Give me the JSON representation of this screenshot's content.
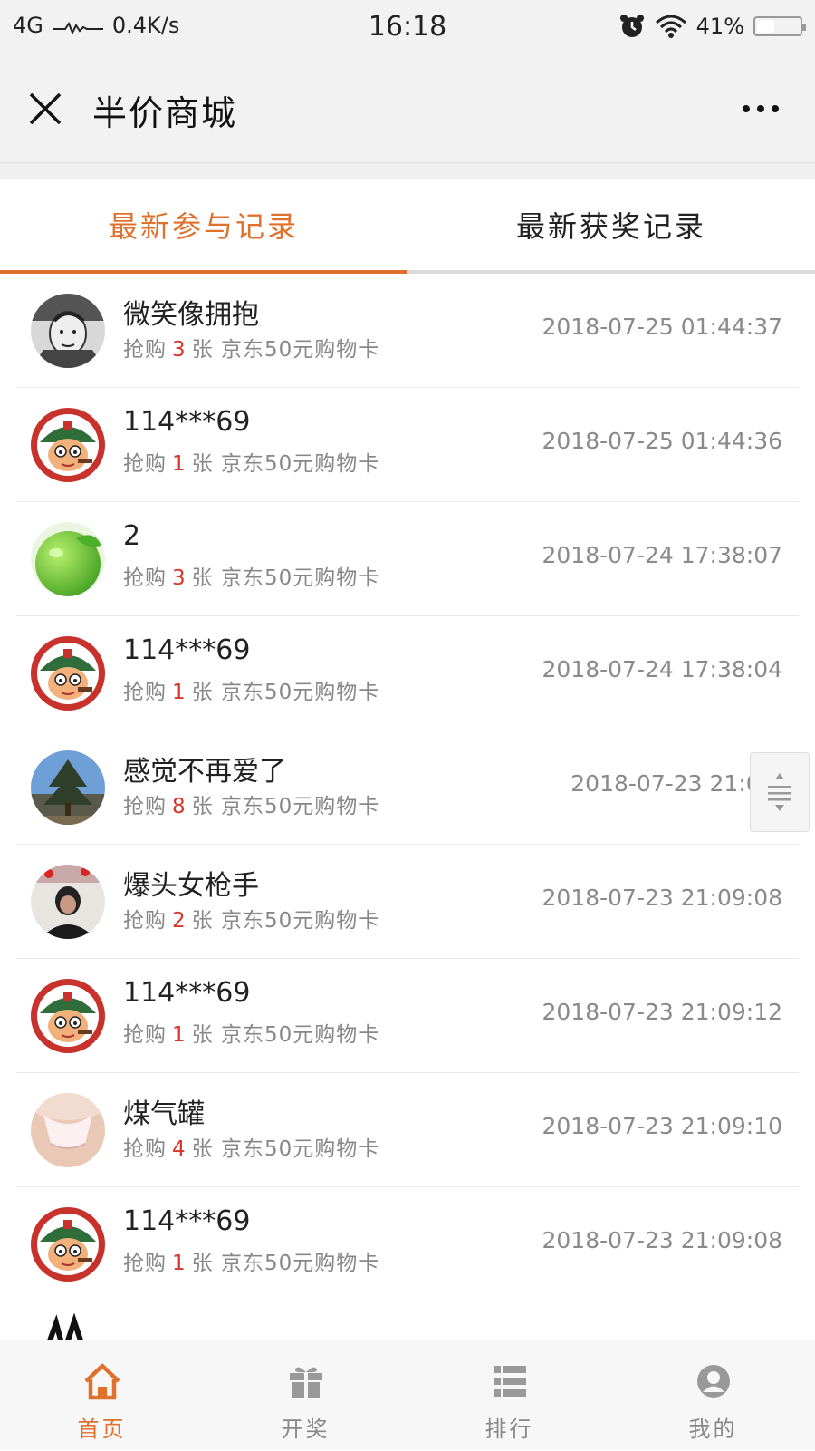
{
  "status_bar": {
    "network": "4G",
    "speed": "0.4K/s",
    "time": "16:18",
    "battery": "41%",
    "battery_level": 0.41
  },
  "nav": {
    "title": "半价商城"
  },
  "tabs": [
    {
      "label": "最新参与记录",
      "active": true
    },
    {
      "label": "最新获奖记录",
      "active": false
    }
  ],
  "records": [
    {
      "name": "微笑像拥抱",
      "prefix": "抢购",
      "qty": "3",
      "unit": "张",
      "product": "京东50元购物卡",
      "time": "2018-07-25 01:44:37",
      "avatar": "sketch-avatar"
    },
    {
      "name": "114***69",
      "prefix": "抢购",
      "qty": "1",
      "unit": "张",
      "product": "京东50元购物卡",
      "time": "2018-07-25 01:44:36",
      "avatar": "cartoon-soldier-avatar"
    },
    {
      "name": "2",
      "prefix": "抢购",
      "qty": "3",
      "unit": "张",
      "product": "京东50元购物卡",
      "time": "2018-07-24 17:38:07",
      "avatar": "green-apple-avatar"
    },
    {
      "name": "114***69",
      "prefix": "抢购",
      "qty": "1",
      "unit": "张",
      "product": "京东50元购物卡",
      "time": "2018-07-24 17:38:04",
      "avatar": "cartoon-soldier-avatar"
    },
    {
      "name": "感觉不再爱了",
      "prefix": "抢购",
      "qty": "8",
      "unit": "张",
      "product": "京东50元购物卡",
      "time": "2018-07-23 21:09:",
      "avatar": "pine-tree-avatar"
    },
    {
      "name": "爆头女枪手",
      "prefix": "抢购",
      "qty": "2",
      "unit": "张",
      "product": "京东50元购物卡",
      "time": "2018-07-23 21:09:08",
      "avatar": "person-photo-avatar"
    },
    {
      "name": "114***69",
      "prefix": "抢购",
      "qty": "1",
      "unit": "张",
      "product": "京东50元购物卡",
      "time": "2018-07-23 21:09:12",
      "avatar": "cartoon-soldier-avatar"
    },
    {
      "name": "煤气罐",
      "prefix": "抢购",
      "qty": "4",
      "unit": "张",
      "product": "京东50元购物卡",
      "time": "2018-07-23 21:09:10",
      "avatar": "skin-photo-avatar"
    },
    {
      "name": "114***69",
      "prefix": "抢购",
      "qty": "1",
      "unit": "张",
      "product": "京东50元购物卡",
      "time": "2018-07-23 21:09:08",
      "avatar": "cartoon-soldier-avatar"
    }
  ],
  "bottom_tabs": [
    {
      "label": "首页",
      "icon": "home-icon",
      "active": true
    },
    {
      "label": "开奖",
      "icon": "gift-icon",
      "active": false
    },
    {
      "label": "排行",
      "icon": "list-icon",
      "active": false
    },
    {
      "label": "我的",
      "icon": "profile-icon",
      "active": false
    }
  ],
  "colors": {
    "accent": "#e0712c",
    "quantity": "#d9362b",
    "muted": "#888888"
  }
}
